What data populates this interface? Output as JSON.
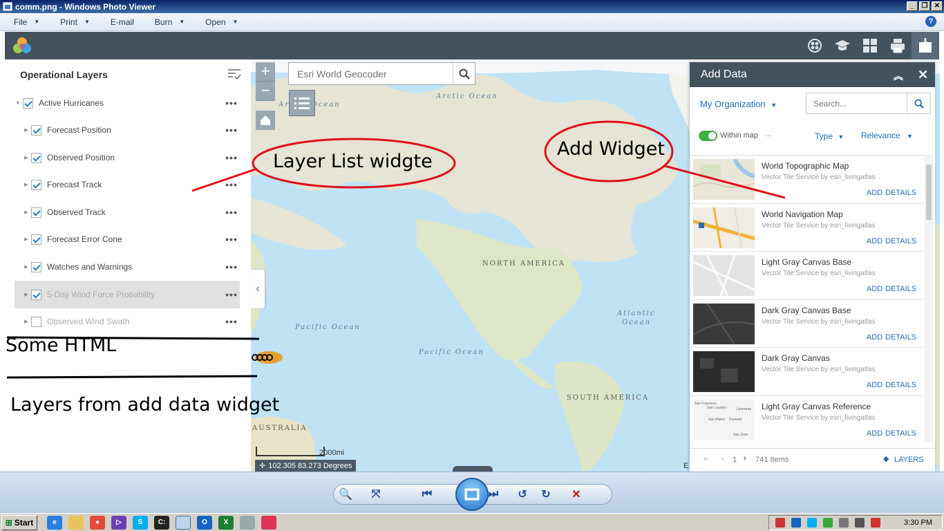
{
  "window": {
    "title": "comm.png - Windows Photo Viewer",
    "menu": [
      {
        "label": "File",
        "has_dropdown": true
      },
      {
        "label": "Print",
        "has_dropdown": true
      },
      {
        "label": "E-mail",
        "has_dropdown": false
      },
      {
        "label": "Burn",
        "has_dropdown": true
      },
      {
        "label": "Open",
        "has_dropdown": true
      }
    ],
    "help_icon": "?"
  },
  "app": {
    "header_icons": [
      "basemap-gallery-icon",
      "about-icon",
      "layout-grid-icon",
      "print-icon",
      "add-data-icon"
    ]
  },
  "layer_list": {
    "title": "Operational Layers",
    "options_icon": "layer-options-icon",
    "more_label": "•••",
    "layers": [
      {
        "label": "Active Hurricanes",
        "checked": true,
        "expanded": true,
        "level": 0,
        "dim": false
      },
      {
        "label": "Forecast Position",
        "checked": true,
        "level": 1,
        "dim": false
      },
      {
        "label": "Observed Position",
        "checked": true,
        "level": 1,
        "dim": false
      },
      {
        "label": "Forecast Track",
        "checked": true,
        "level": 1,
        "dim": false
      },
      {
        "label": "Observed Track",
        "checked": true,
        "level": 1,
        "dim": false
      },
      {
        "label": "Forecast Error Cone",
        "checked": true,
        "level": 1,
        "dim": false
      },
      {
        "label": "Watches and Warnings",
        "checked": true,
        "level": 1,
        "dim": false
      },
      {
        "label": "5-Day Wind Force Probability",
        "checked": true,
        "level": 1,
        "dim": true,
        "selected": true
      },
      {
        "label": "Observed Wind Swath",
        "checked": false,
        "level": 1,
        "dim": true
      }
    ]
  },
  "annotations": {
    "layer_list_callout": "Layer List widgte",
    "add_widget_callout": "Add Widget",
    "some_html": "Some HTML",
    "layers_from_add_data": "Layers from add data widget"
  },
  "map": {
    "search_placeholder": "Esri World Geocoder",
    "zoom_in": "+",
    "zoom_out": "−",
    "labels": {
      "arctic1": "Arctic Ocean",
      "arctic2": "Arctic Ocean",
      "north_america": "NORTH AMERICA",
      "atlantic1": "Atlantic",
      "atlantic2": "Ocean",
      "pacific1": "Pacific Ocean",
      "pacific2": "Pacific Ocean",
      "south_america": "SOUTH AMERICA",
      "australia": "AUSTRALIA"
    },
    "scale_label": "2000mi",
    "coordinates": "102.305 83.273 Degrees",
    "attribution": "E"
  },
  "add_data": {
    "title": "Add Data",
    "scope": "My Organization",
    "search_placeholder": "Search...",
    "within_map": "Within map",
    "more": "...",
    "type_label": "Type",
    "relevance_label": "Relevance",
    "add_label": "ADD",
    "details_label": "DETAILS",
    "items": [
      {
        "title": "World Topographic Map",
        "subtitle": "Vector Tile Service by esri_livingatlas",
        "thumb": "topo"
      },
      {
        "title": "World Navigation Map",
        "subtitle": "Vector Tile Service by esri_livingatlas",
        "thumb": "nav"
      },
      {
        "title": "Light Gray Canvas Base",
        "subtitle": "Vector Tile Service by esri_livingatlas",
        "thumb": "lightgray"
      },
      {
        "title": "Dark Gray Canvas Base",
        "subtitle": "Vector Tile Service by esri_livingatlas",
        "thumb": "darkgray"
      },
      {
        "title": "Dark Gray Canvas",
        "subtitle": "Vector Tile Service by esri_livingatlas",
        "thumb": "darkgray2"
      },
      {
        "title": "Light Gray Canvas Reference",
        "subtitle": "Vector Tile Service by esri_livingatlas",
        "thumb": "reference"
      }
    ],
    "thumb_text": {
      "reference": [
        "San Francisco",
        "San Leandro",
        "Livermore",
        "San Mateo",
        "Fremont",
        "San Jose"
      ]
    },
    "footer": {
      "page": "1",
      "count": "741 Items",
      "layers_label": "LAYERS"
    }
  },
  "taskbar": {
    "start_label": "Start",
    "clock": "3:30 PM"
  },
  "colors": {
    "header_bg": "#44525e",
    "accent_blue": "#1f6bb5",
    "annotation_red": "#e0101a",
    "ocean": "#bfe3f5",
    "land": "#e8e6d5"
  }
}
